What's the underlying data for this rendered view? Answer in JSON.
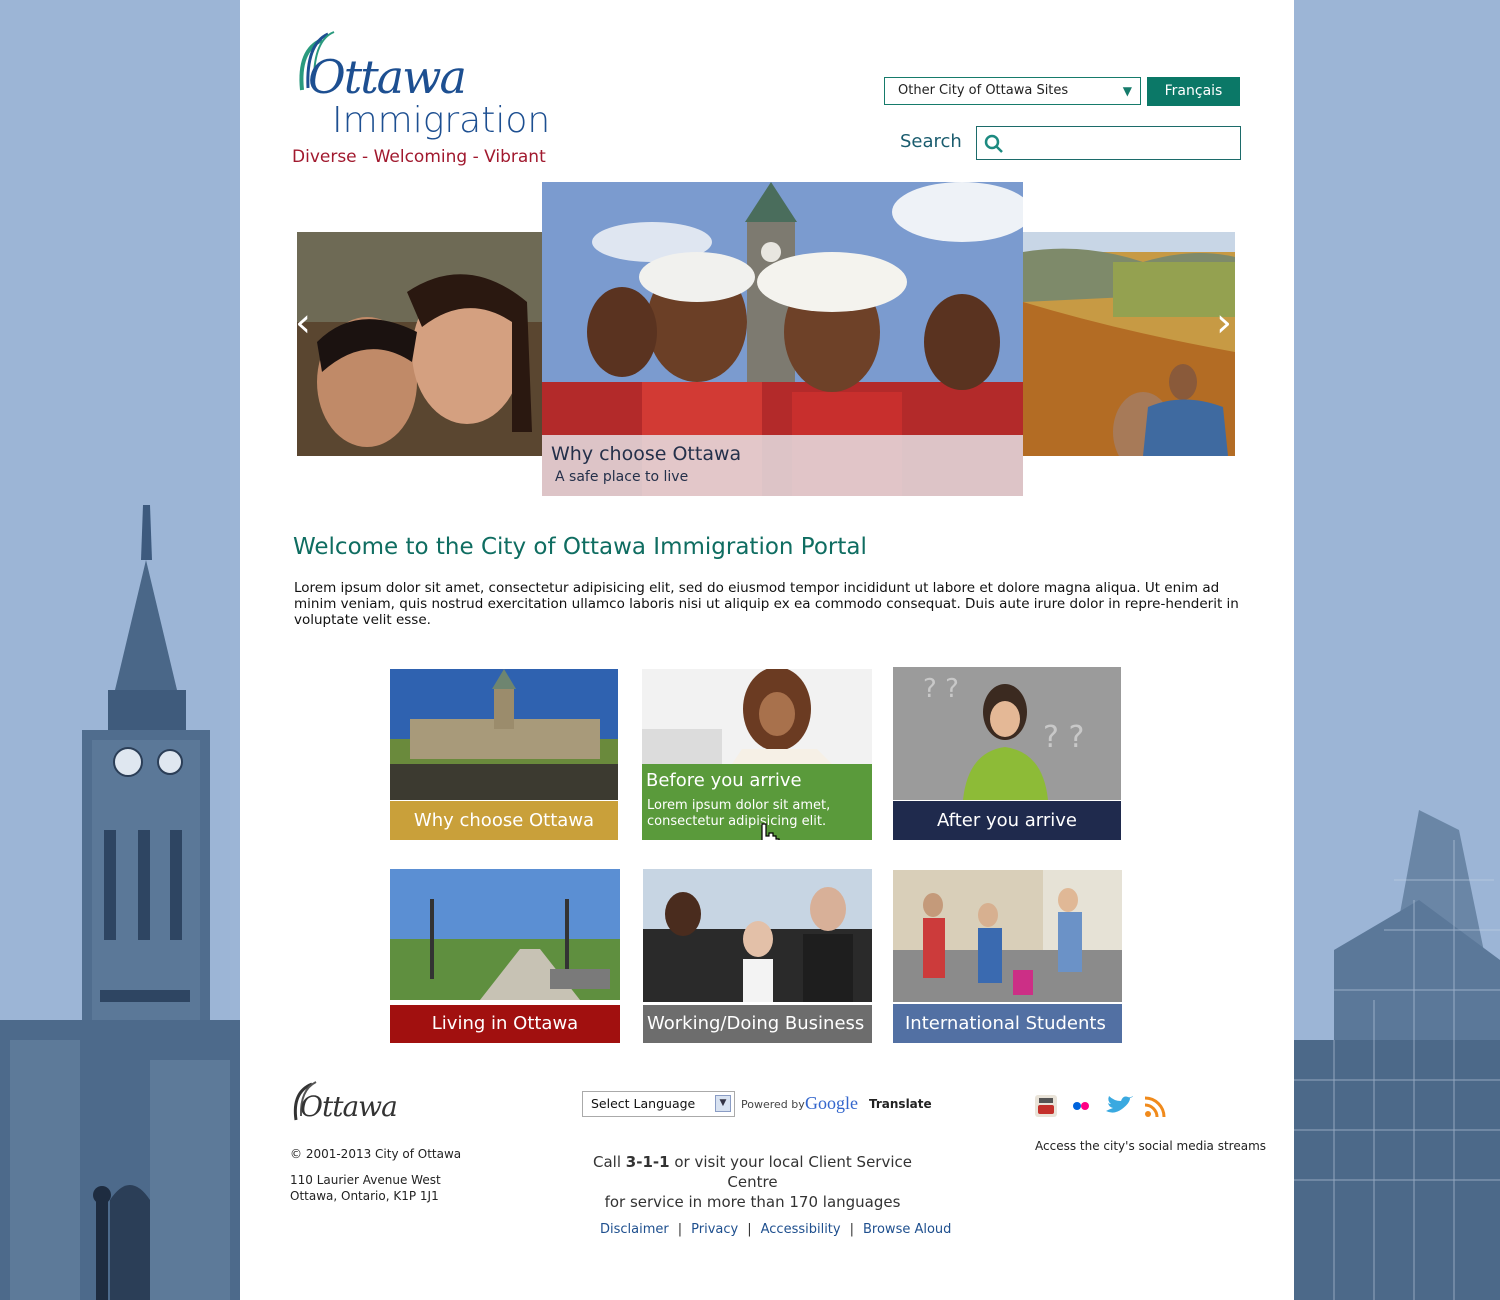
{
  "header": {
    "logo_word": "Ottawa",
    "logo_sub": "Immigration",
    "tagline": "Diverse - Welcoming - Vibrant",
    "sites_select": "Other City of Ottawa Sites",
    "language_button": "Français",
    "search_label": "Search",
    "search_value": ""
  },
  "carousel": {
    "caption_title": "Why choose Ottawa",
    "caption_sub": "A safe place to live",
    "prev_arrow": "‹",
    "next_arrow": "›"
  },
  "welcome": {
    "title": "Welcome to the City of Ottawa Immigration Portal",
    "text": "Lorem ipsum dolor sit amet, consectetur adipisicing elit, sed do eiusmod tempor incididunt ut labore et dolore magna aliqua. Ut enim ad minim veniam, quis nostrud exercitation ullamco laboris nisi ut aliquip ex ea commodo consequat. Duis aute irure dolor in repre-henderit in voluptate velit esse."
  },
  "tiles": [
    {
      "label": "Why choose Ottawa",
      "color": "#c9a03a"
    },
    {
      "label": "Before you arrive",
      "sub": "Lorem ipsum dolor sit amet, consectetur adipisicing elit.",
      "color": "#5a9a3b"
    },
    {
      "label": "After you arrive",
      "color": "#1f2a4d"
    },
    {
      "label": "Living in Ottawa",
      "color": "#a1100f"
    },
    {
      "label": "Working/Doing Business",
      "color": "#6d6d6d"
    },
    {
      "label": "International Students",
      "color": "#5270a3"
    }
  ],
  "footer": {
    "logo_word": "Ottawa",
    "copyright": "© 2001-2013 City of Ottawa",
    "address_line1": "110 Laurier Avenue West",
    "address_line2": "Ottawa, Ontario, K1P 1J1",
    "select_language": "Select Language",
    "powered_by": "Powered by",
    "google": "Google",
    "translate": "Translate",
    "call_pre": "Call",
    "call_number": "3-1-1",
    "call_post": "or visit your local Client Service Centre",
    "call_line2": "for service in more than 170 languages",
    "social_caption": "Access the city's social media streams",
    "links": [
      "Disclaimer",
      "Privacy",
      "Accessibility",
      "Browse Aloud"
    ]
  }
}
